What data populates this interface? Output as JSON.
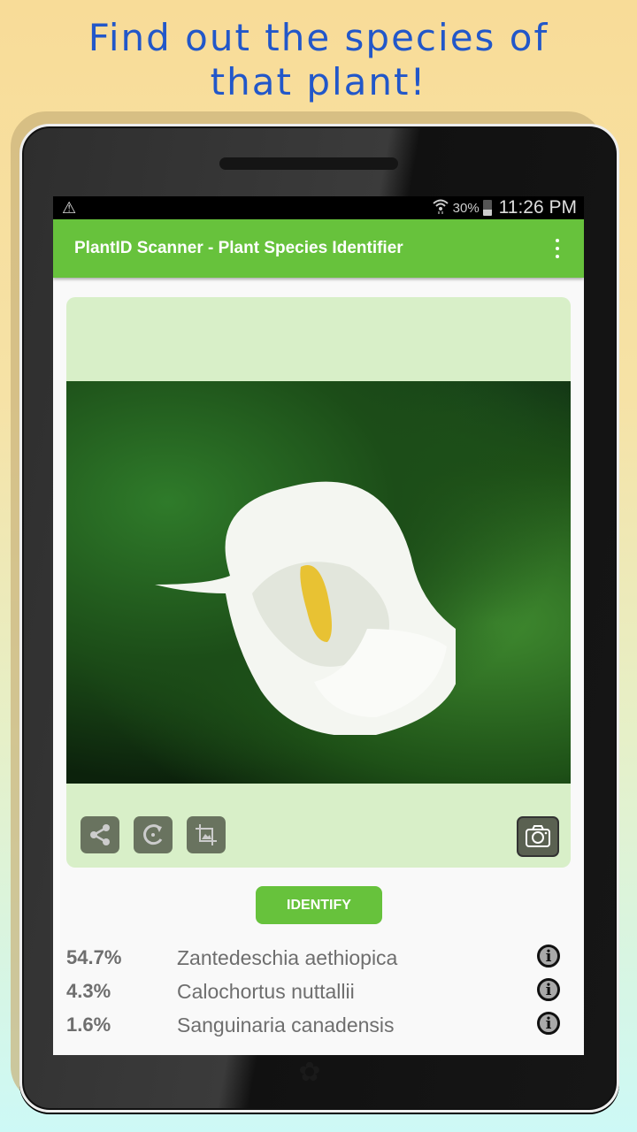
{
  "promo": {
    "line1": "Find out the species of",
    "line2": "that plant!"
  },
  "statusbar": {
    "warning_icon": "warning-icon",
    "wifi_icon": "wifi-icon",
    "battery_percent": "30%",
    "battery_icon": "battery-icon",
    "time": "11:26 PM"
  },
  "appbar": {
    "title": "PlantID Scanner - Plant Species Identifier",
    "menu_icon": "overflow-menu-icon"
  },
  "card": {
    "image_alt": "White calla lily flower",
    "tools": [
      {
        "name": "share",
        "icon": "share-icon"
      },
      {
        "name": "rotate",
        "icon": "rotate-icon"
      },
      {
        "name": "crop",
        "icon": "crop-icon"
      }
    ],
    "camera_icon": "camera-icon"
  },
  "identify_button": {
    "label": "IDENTIFY"
  },
  "results": [
    {
      "confidence": "54.7%",
      "species": "Zantedeschia aethiopica",
      "info_icon": "info-icon"
    },
    {
      "confidence": "4.3%",
      "species": "Calochortus nuttallii",
      "info_icon": "info-icon"
    },
    {
      "confidence": "1.6%",
      "species": "Sanguinaria canadensis",
      "info_icon": "info-icon"
    }
  ],
  "colors": {
    "accent": "#67c23c",
    "card_bg": "#d8efc8",
    "promo_text": "#2257c9"
  }
}
